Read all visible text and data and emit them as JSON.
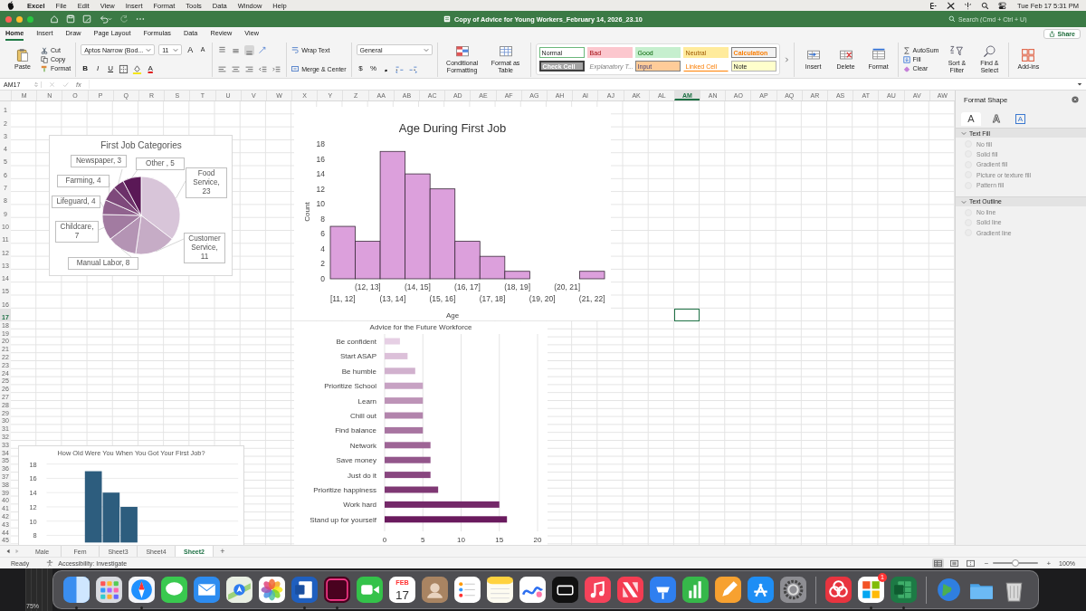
{
  "menu_bar": {
    "app": "Excel",
    "items": [
      "File",
      "Edit",
      "View",
      "Insert",
      "Format",
      "Tools",
      "Data",
      "Window",
      "Help"
    ],
    "clock": "Tue Feb 17  5:31 PM"
  },
  "title_bar": {
    "title": "Copy of Advice for Young Workers_February 14, 2026_23.10",
    "search": {
      "placeholder": "Search (Cmd + Ctrl + U)"
    }
  },
  "ribbon_tabs": [
    {
      "label": "Home",
      "selected": true
    },
    {
      "label": "Insert",
      "selected": false
    },
    {
      "label": "Draw",
      "selected": false
    },
    {
      "label": "Page Layout",
      "selected": false
    },
    {
      "label": "Formulas",
      "selected": false
    },
    {
      "label": "Data",
      "selected": false
    },
    {
      "label": "Review",
      "selected": false
    },
    {
      "label": "View",
      "selected": false
    }
  ],
  "share": "Share",
  "ribbon": {
    "paste": "Paste",
    "cut": "Cut",
    "copy": "Copy",
    "format_painter": "Format",
    "font_name": "Aptos Narrow (Bod...",
    "font_size": "11",
    "grow_font": "A",
    "shrink_font": "A",
    "bold": "B",
    "italic": "I",
    "underline": "U",
    "font_color": "A",
    "vertical_align": [
      {
        "kind": "top",
        "selected": false
      },
      {
        "kind": "middle",
        "selected": false
      },
      {
        "kind": "bottom",
        "selected": true
      }
    ],
    "wrap_text": "Wrap Text",
    "merge_center": "Merge & Center",
    "number_format": "General",
    "currency": "$",
    "percent": "%",
    "comma": "❟",
    "conditional_formatting": "Conditional Formatting",
    "format_as_table": "Format as Table",
    "cell_styles": [
      {
        "label": "Normal",
        "kind": "normal"
      },
      {
        "label": "Bad",
        "kind": "bad"
      },
      {
        "label": "Good",
        "kind": "good"
      },
      {
        "label": "Neutral",
        "kind": "neutral"
      },
      {
        "label": "Calculation",
        "kind": "calculation"
      },
      {
        "label": "Check Cell",
        "kind": "check"
      },
      {
        "label": "Explanatory T...",
        "kind": "explanatory"
      },
      {
        "label": "Input",
        "kind": "input"
      },
      {
        "label": "Linked Cell",
        "kind": "linked"
      },
      {
        "label": "Note",
        "kind": "note"
      }
    ],
    "cells_buttons": [
      {
        "label": "Insert",
        "kind": "insert"
      },
      {
        "label": "Delete",
        "kind": "delete"
      },
      {
        "label": "Format",
        "kind": "format"
      }
    ],
    "autosum": "AutoSum",
    "fill": "Fill",
    "clear": "Clear",
    "sort_filter": "Sort & Filter",
    "find_select": "Find & Select",
    "add_ins": "Add-ins"
  },
  "formula_bar": {
    "name_box": "AM17",
    "fx": "fx"
  },
  "columns": [
    {
      "label": "M",
      "selected": false
    },
    {
      "label": "N",
      "selected": false
    },
    {
      "label": "O",
      "selected": false
    },
    {
      "label": "P",
      "selected": false
    },
    {
      "label": "Q",
      "selected": false
    },
    {
      "label": "R",
      "selected": false
    },
    {
      "label": "S",
      "selected": false
    },
    {
      "label": "T",
      "selected": false
    },
    {
      "label": "U",
      "selected": false
    },
    {
      "label": "V",
      "selected": false
    },
    {
      "label": "W",
      "selected": false
    },
    {
      "label": "X",
      "selected": false
    },
    {
      "label": "Y",
      "selected": false
    },
    {
      "label": "Z",
      "selected": false
    },
    {
      "label": "AA",
      "selected": false
    },
    {
      "label": "AB",
      "selected": false
    },
    {
      "label": "AC",
      "selected": false
    },
    {
      "label": "AD",
      "selected": false
    },
    {
      "label": "AE",
      "selected": false
    },
    {
      "label": "AF",
      "selected": false
    },
    {
      "label": "AG",
      "selected": false
    },
    {
      "label": "AH",
      "selected": false
    },
    {
      "label": "AI",
      "selected": false
    },
    {
      "label": "AJ",
      "selected": false
    },
    {
      "label": "AK",
      "selected": false
    },
    {
      "label": "AL",
      "selected": false
    },
    {
      "label": "AM",
      "selected": true
    },
    {
      "label": "AN",
      "selected": false
    },
    {
      "label": "AO",
      "selected": false
    },
    {
      "label": "AP",
      "selected": false
    },
    {
      "label": "AQ",
      "selected": false
    },
    {
      "label": "AR",
      "selected": false
    },
    {
      "label": "AS",
      "selected": false
    },
    {
      "label": "AT",
      "selected": false
    },
    {
      "label": "AU",
      "selected": false
    },
    {
      "label": "AV",
      "selected": false
    },
    {
      "label": "AW",
      "selected": false
    }
  ],
  "rows": [
    {
      "label": "1",
      "selected": false
    },
    {
      "label": "2",
      "selected": false
    },
    {
      "label": "3",
      "selected": false
    },
    {
      "label": "4",
      "selected": false
    },
    {
      "label": "5",
      "selected": false
    },
    {
      "label": "6",
      "selected": false
    },
    {
      "label": "7",
      "selected": false
    },
    {
      "label": "8",
      "selected": false
    },
    {
      "label": "9",
      "selected": false
    },
    {
      "label": "10",
      "selected": false
    },
    {
      "label": "11",
      "selected": false
    },
    {
      "label": "12",
      "selected": false
    },
    {
      "label": "13",
      "selected": false
    },
    {
      "label": "14",
      "selected": false
    },
    {
      "label": "15",
      "selected": false
    },
    {
      "label": "16",
      "selected": false
    },
    {
      "label": "17",
      "selected": true
    },
    {
      "label": "18",
      "selected": false
    },
    {
      "label": "19",
      "selected": false
    },
    {
      "label": "20",
      "selected": false
    },
    {
      "label": "21",
      "selected": false
    },
    {
      "label": "22",
      "selected": false
    },
    {
      "label": "23",
      "selected": false
    },
    {
      "label": "24",
      "selected": false
    },
    {
      "label": "25",
      "selected": false
    },
    {
      "label": "26",
      "selected": false
    },
    {
      "label": "27",
      "selected": false
    },
    {
      "label": "28",
      "selected": false
    },
    {
      "label": "29",
      "selected": false
    },
    {
      "label": "30",
      "selected": false
    },
    {
      "label": "31",
      "selected": false
    },
    {
      "label": "32",
      "selected": false
    },
    {
      "label": "33",
      "selected": false
    },
    {
      "label": "34",
      "selected": false
    },
    {
      "label": "35",
      "selected": false
    },
    {
      "label": "36",
      "selected": false
    },
    {
      "label": "37",
      "selected": false
    },
    {
      "label": "38",
      "selected": false
    },
    {
      "label": "39",
      "selected": false
    },
    {
      "label": "40",
      "selected": false
    },
    {
      "label": "41",
      "selected": false
    },
    {
      "label": "42",
      "selected": false
    },
    {
      "label": "43",
      "selected": false
    },
    {
      "label": "44",
      "selected": false
    },
    {
      "label": "45",
      "selected": false
    }
  ],
  "charts": {
    "pie": {
      "chart_data": {
        "type": "pie",
        "title": "First Job Categories",
        "values": [
          23,
          11,
          8,
          7,
          4,
          4,
          3,
          5
        ],
        "value_labels": [
          "Food Service, 23",
          "Customer Service, 11",
          "Manual Labor, 8",
          "Childcare, 7",
          "Lifeguard, 4",
          "Farming, 4",
          "Newspaper, 3",
          "Other , 5"
        ]
      }
    },
    "histogram": {
      "chart_data": {
        "type": "bar",
        "title": "Age During First Job",
        "xlabel": "Age",
        "ylabel": "Count",
        "categories": [
          "[11, 12]",
          "(12, 13]",
          "(13, 14]",
          "(14, 15]",
          "(15, 16]",
          "(16, 17]",
          "(17, 18]",
          "(18, 19]",
          "(19, 20]",
          "(20, 21]",
          "(21, 22]"
        ],
        "values": [
          7,
          5,
          17,
          14,
          12,
          5,
          3,
          1,
          0,
          0,
          1
        ],
        "ylim": [
          0,
          18
        ],
        "yticks": [
          0,
          2,
          4,
          6,
          8,
          10,
          12,
          14,
          16,
          18
        ]
      }
    },
    "advice": {
      "chart_data": {
        "type": "bar",
        "orientation": "horizontal",
        "title": "Advice for the Future Workforce",
        "categories": [
          "Be confident",
          "Start ASAP",
          "Be humble",
          "Prioritize School",
          "Learn",
          "Chill out",
          "Find balance",
          "Network",
          "Save money",
          "Just do it",
          "Prioritize happiness",
          "Work hard",
          "Stand up for yourself"
        ],
        "values": [
          2,
          3,
          4,
          5,
          5,
          5,
          5,
          6,
          6,
          6,
          7,
          15,
          16
        ],
        "xlim": [
          0,
          20
        ],
        "xticks": [
          0,
          5,
          10,
          15,
          20
        ],
        "grid": true
      }
    },
    "first_job_age": {
      "chart_data": {
        "type": "bar",
        "title": "How Old Were You When You Got Your First Job?",
        "values": [
          null,
          null,
          17,
          14,
          12,
          null,
          null,
          null,
          null,
          null,
          null
        ],
        "ylim": [
          7,
          18
        ],
        "yticks": [
          8,
          10,
          12,
          14,
          16,
          18
        ],
        "grid": true
      }
    }
  },
  "format_panel": {
    "title": "Format Shape",
    "tabs": [
      {
        "glyph": "A",
        "kind": "fill",
        "selected": true
      },
      {
        "glyph": "A",
        "kind": "effects",
        "selected": false
      },
      {
        "glyph": "A",
        "kind": "textbox",
        "selected": false
      }
    ],
    "sections": [
      {
        "title": "Text Fill",
        "expanded": true,
        "options": [
          {
            "label": "No fill",
            "selected": false,
            "disabled": true
          },
          {
            "label": "Solid fill",
            "selected": false,
            "disabled": true
          },
          {
            "label": "Gradient fill",
            "selected": false,
            "disabled": true
          },
          {
            "label": "Picture or texture fill",
            "selected": false,
            "disabled": true
          },
          {
            "label": "Pattern fill",
            "selected": false,
            "disabled": true
          }
        ]
      },
      {
        "title": "Text Outline",
        "expanded": true,
        "options": [
          {
            "label": "No line",
            "selected": false,
            "disabled": true
          },
          {
            "label": "Solid line",
            "selected": false,
            "disabled": true
          },
          {
            "label": "Gradient line",
            "selected": false,
            "disabled": true
          }
        ]
      }
    ]
  },
  "sheet_tabs": [
    {
      "label": "Male",
      "selected": false
    },
    {
      "label": "Fem",
      "selected": false
    },
    {
      "label": "Sheet3",
      "selected": false
    },
    {
      "label": "Sheet4",
      "selected": false
    },
    {
      "label": "Sheet2",
      "selected": true
    }
  ],
  "add_sheet": "+",
  "status_bar": {
    "ready": "Ready",
    "accessibility": "Accessibility: Investigate",
    "views": [
      {
        "kind": "normal",
        "selected": true
      },
      {
        "kind": "page_layout",
        "selected": false
      },
      {
        "kind": "page_break",
        "selected": false
      }
    ],
    "zoom": {
      "minus": "−",
      "plus": "+",
      "level": 0.5,
      "label": "100%"
    }
  },
  "background_window": {
    "zoom": "75%"
  },
  "dock": [
    {
      "kind": "finder",
      "running": true
    },
    {
      "kind": "launchpad",
      "running": false
    },
    {
      "kind": "safari",
      "running": true
    },
    {
      "kind": "messages",
      "running": false
    },
    {
      "kind": "mail",
      "running": false
    },
    {
      "kind": "maps",
      "running": false
    },
    {
      "kind": "photos",
      "running": false
    },
    {
      "kind": "word",
      "running": true
    },
    {
      "kind": "indesign",
      "running": true
    },
    {
      "kind": "facetime",
      "running": false
    },
    {
      "kind": "calendar",
      "running": false,
      "month": "FEB",
      "day": "17"
    },
    {
      "kind": "contacts",
      "running": false
    },
    {
      "kind": "reminders",
      "running": false
    },
    {
      "kind": "notes",
      "running": false
    },
    {
      "kind": "freeform",
      "running": false
    },
    {
      "kind": "tv",
      "running": false
    },
    {
      "kind": "music",
      "running": false
    },
    {
      "kind": "news",
      "running": false
    },
    {
      "kind": "keynote",
      "running": false
    },
    {
      "kind": "numbers",
      "running": false
    },
    {
      "kind": "pages",
      "running": false
    },
    {
      "kind": "appstore",
      "running": false
    },
    {
      "kind": "settings",
      "running": false
    },
    {
      "kind": "separator"
    },
    {
      "kind": "creativecloud",
      "running": false
    },
    {
      "kind": "office",
      "running": true,
      "badge": "1"
    },
    {
      "kind": "excel",
      "running": true
    },
    {
      "kind": "separator"
    },
    {
      "kind": "globe",
      "running": false
    },
    {
      "kind": "folder",
      "running": false
    },
    {
      "kind": "trash",
      "running": false
    }
  ]
}
